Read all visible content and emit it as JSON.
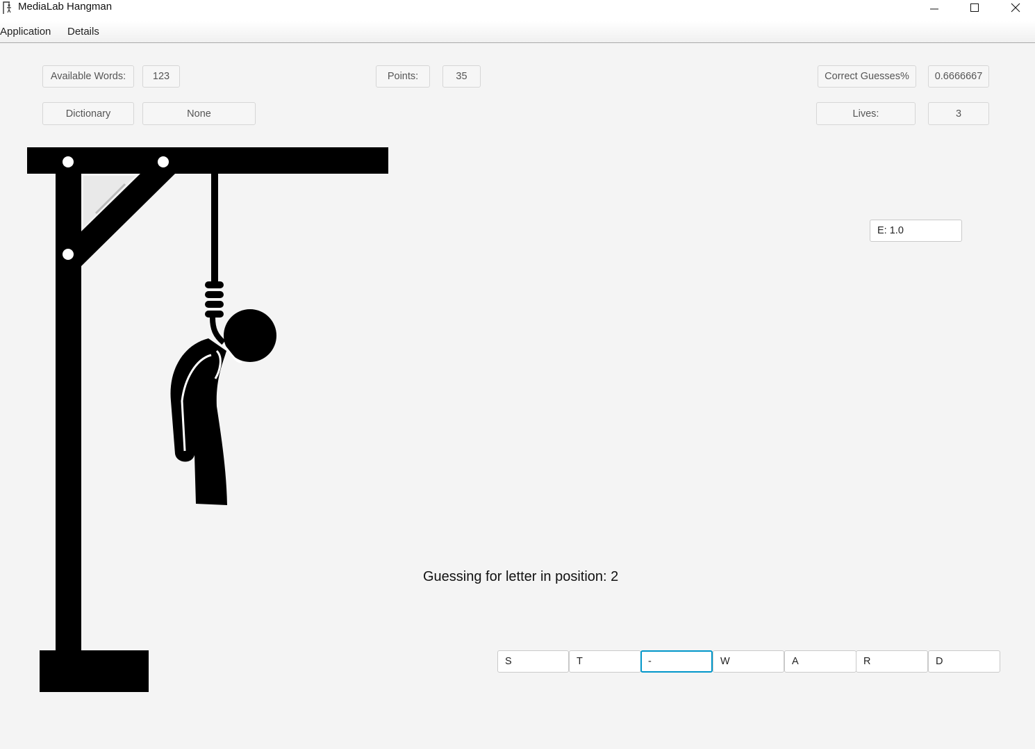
{
  "window": {
    "title": "MediaLab Hangman",
    "controls": [
      "minimize-icon",
      "maximize-icon",
      "close-icon"
    ]
  },
  "menu": {
    "items": [
      "Application",
      "Details"
    ]
  },
  "stats": {
    "available_words_label": "Available Words:",
    "available_words_value": "123",
    "dictionary_label": "Dictionary",
    "dictionary_value": "None",
    "points_label": "Points:",
    "points_value": "35",
    "correct_guesses_label": "Correct Guesses%",
    "correct_guesses_value": "0.6666667",
    "lives_label": "Lives:",
    "lives_value": "3"
  },
  "probability": {
    "text": "E: 1.0"
  },
  "status": {
    "text": "Guessing for letter in position: 2"
  },
  "word": {
    "letters": [
      "S",
      "T",
      "-",
      "W",
      "A",
      "R",
      "D"
    ],
    "focused_index": 2
  },
  "colors": {
    "background": "#f4f4f4",
    "focus_border": "#0096c9",
    "gallows": "#000000"
  },
  "illustration": {
    "icon": "hangman-gallows-icon"
  }
}
